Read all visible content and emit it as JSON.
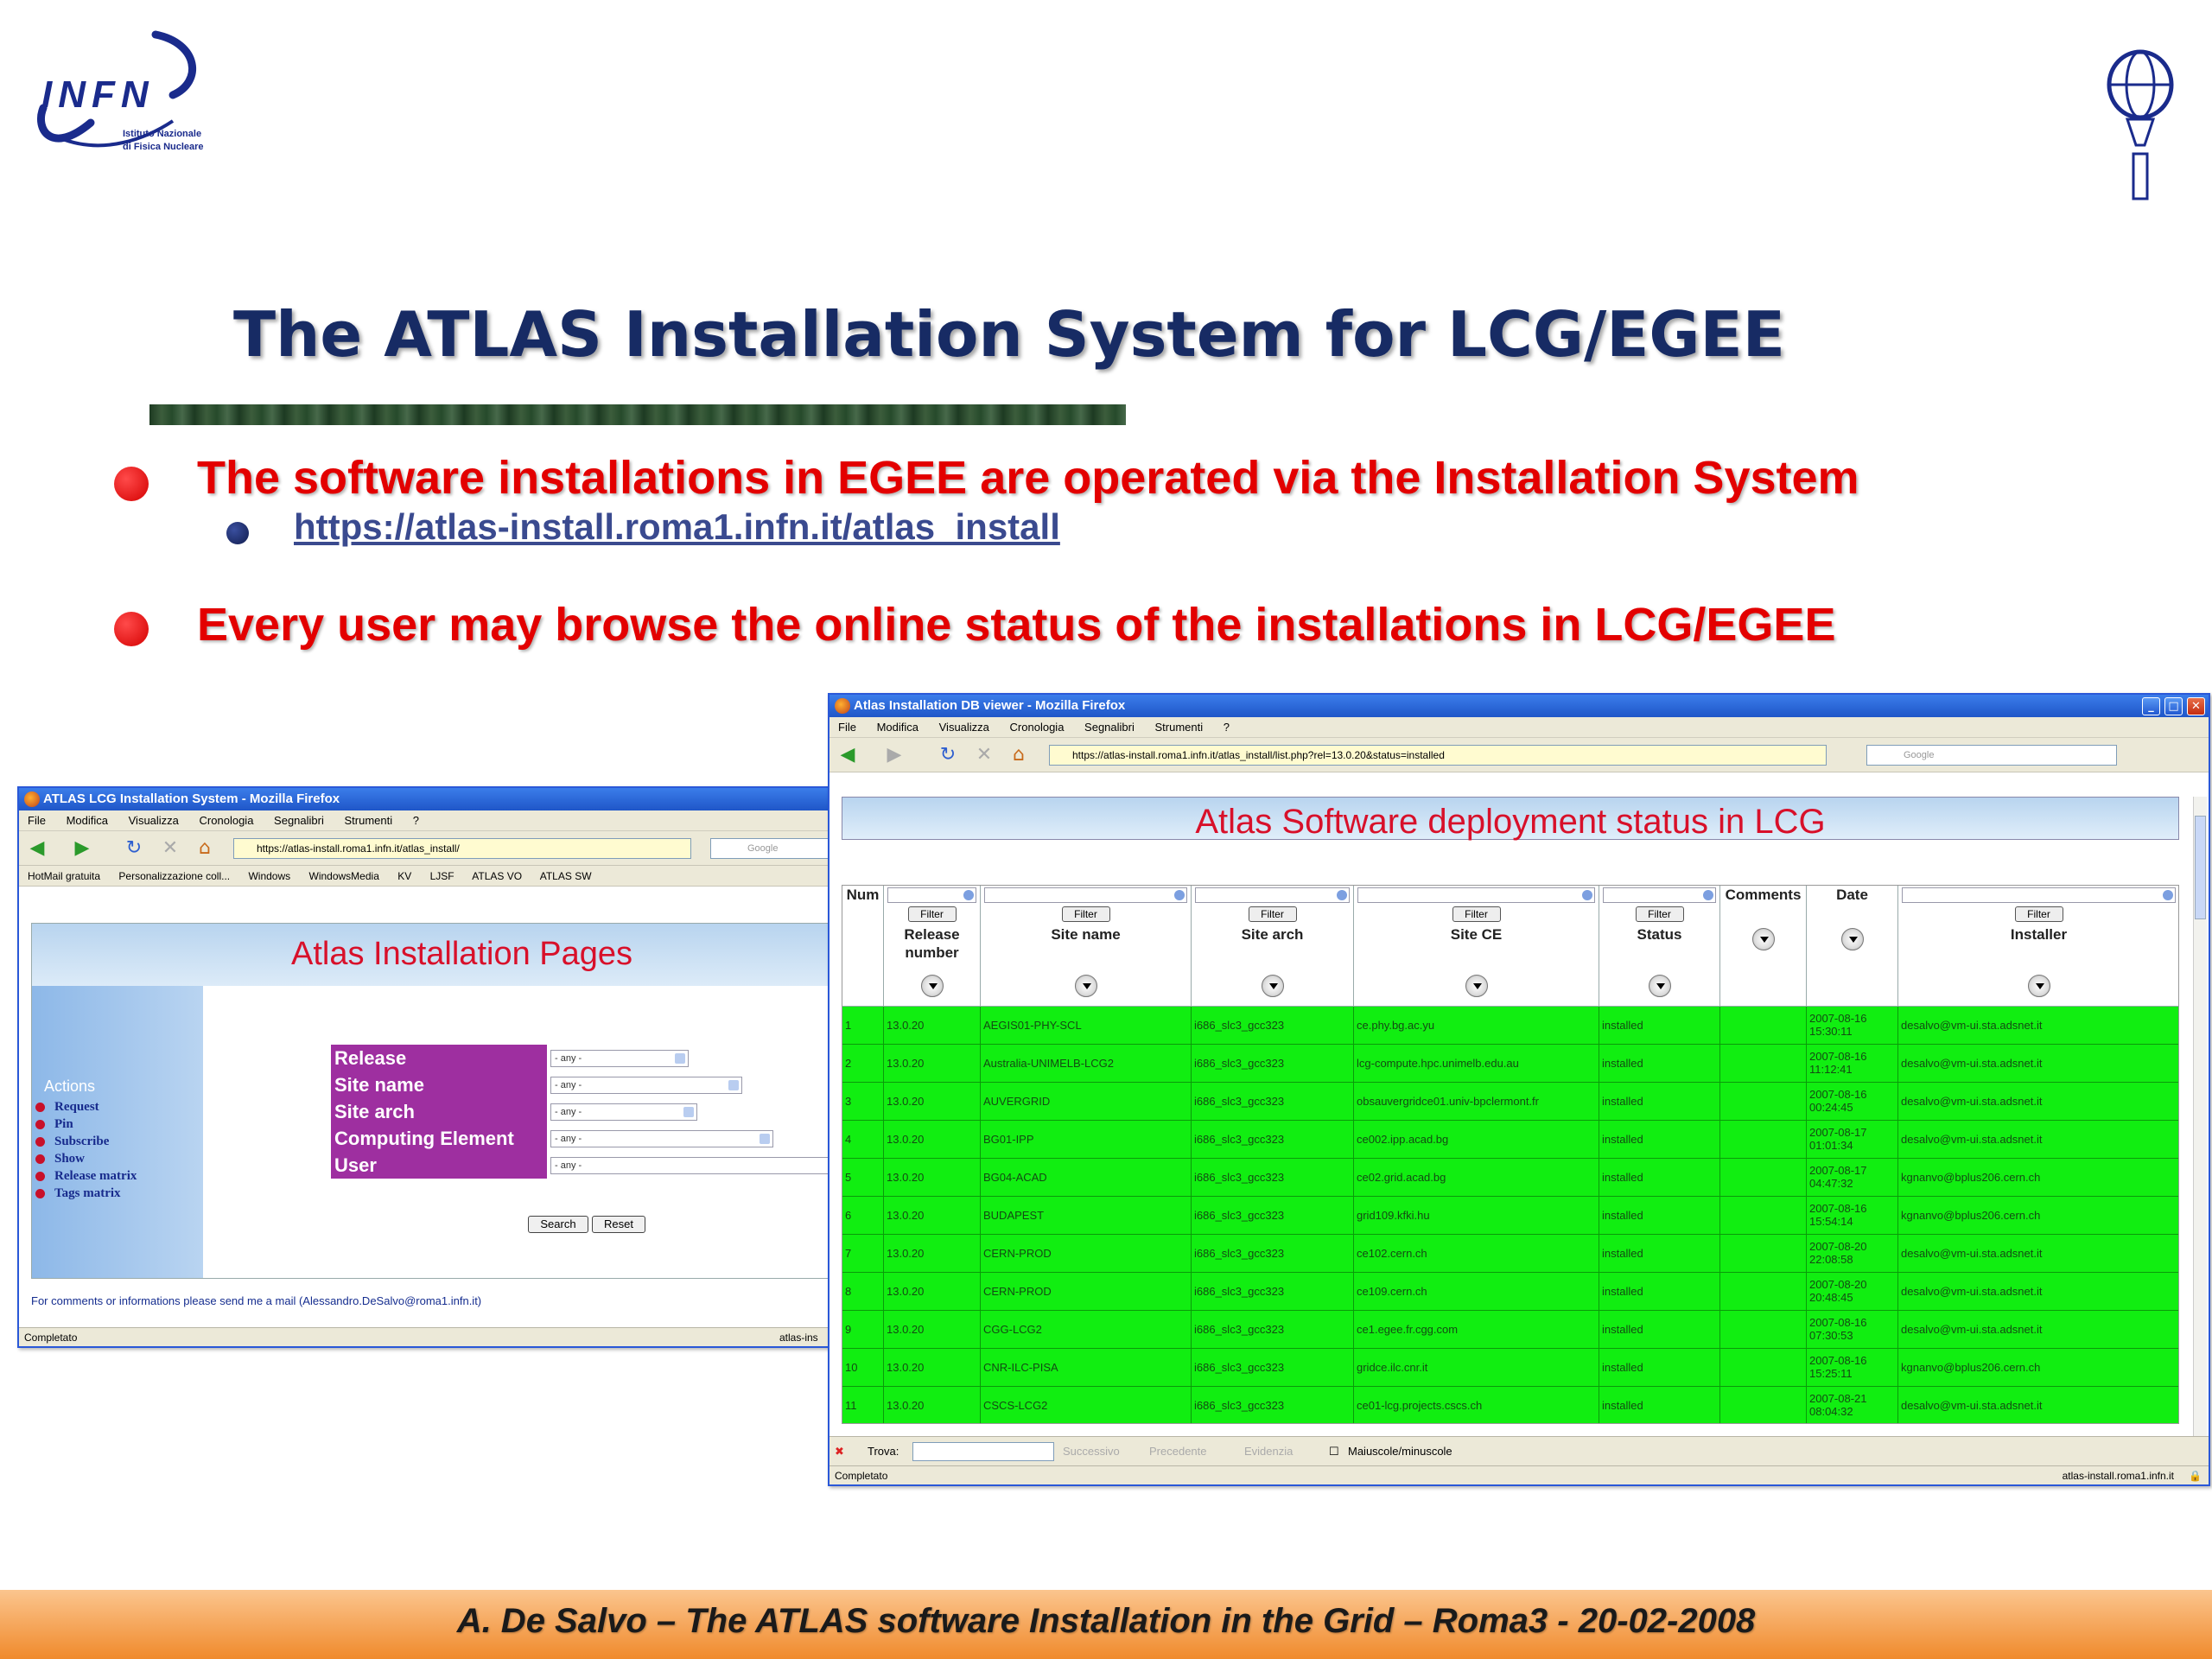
{
  "slide": {
    "title": "The ATLAS Installation System for LCG/EGEE",
    "bullets": [
      {
        "text": "The software installations in EGEE are operated via the Installation System",
        "sub": "https://atlas-install.roma1.infn.it/atlas_install"
      },
      {
        "text": "Every user may browse the online status of the installations in LCG/EGEE"
      }
    ],
    "footer": "A. De Salvo – The ATLAS software Installation in the Grid – Roma3 - 20-02-2008",
    "infn_logo": {
      "word": "INFN",
      "sub": "Istituto Nazionale\ndi Fisica Nucleare"
    },
    "colors": {
      "title": "#172b64",
      "bullet": "#e30000",
      "footer_band": "#f59a3a",
      "green_row": "#11ee11"
    }
  },
  "window1": {
    "title": "ATLAS LCG Installation System - Mozilla Firefox",
    "menu": [
      "File",
      "Modifica",
      "Visualizza",
      "Cronologia",
      "Segnalibri",
      "Strumenti",
      "?"
    ],
    "url": "https://atlas-install.roma1.infn.it/atlas_install/",
    "search_placeholder": "Google",
    "bookmarks": [
      "HotMail gratuita",
      "Personalizzazione coll...",
      "Windows",
      "WindowsMedia",
      "KV",
      "LJSF",
      "ATLAS VO",
      "ATLAS SW"
    ],
    "page_title": "Atlas Installation Pages",
    "actions_label": "Actions",
    "actions": [
      "Request",
      "Pin",
      "Subscribe",
      "Show",
      "Release matrix",
      "Tags matrix"
    ],
    "form_labels": [
      "Release",
      "Site name",
      "Site arch",
      "Computing Element",
      "User"
    ],
    "form_value": "- any -",
    "search_button": "Search",
    "reset_button": "Reset",
    "footer_text": "For comments or informations please send me a mail (Alessandro.DeSalvo@roma1.infn.it)",
    "status": "Completato",
    "status_right": "atlas-ins"
  },
  "window2": {
    "title": "Atlas Installation DB viewer - Mozilla Firefox",
    "menu": [
      "File",
      "Modifica",
      "Visualizza",
      "Cronologia",
      "Segnalibri",
      "Strumenti",
      "?"
    ],
    "url": "https://atlas-install.roma1.infn.it/atlas_install/list.php?rel=13.0.20&status=installed",
    "search_placeholder": "Google",
    "page_title": "Atlas Software deployment status in LCG",
    "filter_label": "Filter",
    "columns": [
      "Num",
      "Release\nnumber",
      "Site name",
      "Site arch",
      "Site CE",
      "Status",
      "Comments",
      "Date",
      "Installer"
    ],
    "rows": [
      [
        "1",
        "13.0.20",
        "AEGIS01-PHY-SCL",
        "i686_slc3_gcc323",
        "ce.phy.bg.ac.yu",
        "installed",
        "",
        "2007-08-16\n15:30:11",
        "desalvo@vm-ui.sta.adsnet.it"
      ],
      [
        "2",
        "13.0.20",
        "Australia-UNIMELB-LCG2",
        "i686_slc3_gcc323",
        "lcg-compute.hpc.unimelb.edu.au",
        "installed",
        "",
        "2007-08-16\n11:12:41",
        "desalvo@vm-ui.sta.adsnet.it"
      ],
      [
        "3",
        "13.0.20",
        "AUVERGRID",
        "i686_slc3_gcc323",
        "obsauvergridce01.univ-bpclermont.fr",
        "installed",
        "",
        "2007-08-16\n00:24:45",
        "desalvo@vm-ui.sta.adsnet.it"
      ],
      [
        "4",
        "13.0.20",
        "BG01-IPP",
        "i686_slc3_gcc323",
        "ce002.ipp.acad.bg",
        "installed",
        "",
        "2007-08-17\n01:01:34",
        "desalvo@vm-ui.sta.adsnet.it"
      ],
      [
        "5",
        "13.0.20",
        "BG04-ACAD",
        "i686_slc3_gcc323",
        "ce02.grid.acad.bg",
        "installed",
        "",
        "2007-08-17\n04:47:32",
        "kgnanvo@bplus206.cern.ch"
      ],
      [
        "6",
        "13.0.20",
        "BUDAPEST",
        "i686_slc3_gcc323",
        "grid109.kfki.hu",
        "installed",
        "",
        "2007-08-16\n15:54:14",
        "kgnanvo@bplus206.cern.ch"
      ],
      [
        "7",
        "13.0.20",
        "CERN-PROD",
        "i686_slc3_gcc323",
        "ce102.cern.ch",
        "installed",
        "",
        "2007-08-20\n22:08:58",
        "desalvo@vm-ui.sta.adsnet.it"
      ],
      [
        "8",
        "13.0.20",
        "CERN-PROD",
        "i686_slc3_gcc323",
        "ce109.cern.ch",
        "installed",
        "",
        "2007-08-20\n20:48:45",
        "desalvo@vm-ui.sta.adsnet.it"
      ],
      [
        "9",
        "13.0.20",
        "CGG-LCG2",
        "i686_slc3_gcc323",
        "ce1.egee.fr.cgg.com",
        "installed",
        "",
        "2007-08-16\n07:30:53",
        "desalvo@vm-ui.sta.adsnet.it"
      ],
      [
        "10",
        "13.0.20",
        "CNR-ILC-PISA",
        "i686_slc3_gcc323",
        "gridce.ilc.cnr.it",
        "installed",
        "",
        "2007-08-16\n15:25:11",
        "kgnanvo@bplus206.cern.ch"
      ],
      [
        "11",
        "13.0.20",
        "CSCS-LCG2",
        "i686_slc3_gcc323",
        "ce01-lcg.projects.cscs.ch",
        "installed",
        "",
        "2007-08-21\n08:04:32",
        "desalvo@vm-ui.sta.adsnet.it"
      ]
    ],
    "find": {
      "label": "Trova:",
      "next": "Successivo",
      "prev": "Precedente",
      "highlight": "Evidenzia",
      "match_case": "Maiuscole/minuscole"
    },
    "status": "Completato",
    "status_right": "atlas-install.roma1.infn.it"
  }
}
